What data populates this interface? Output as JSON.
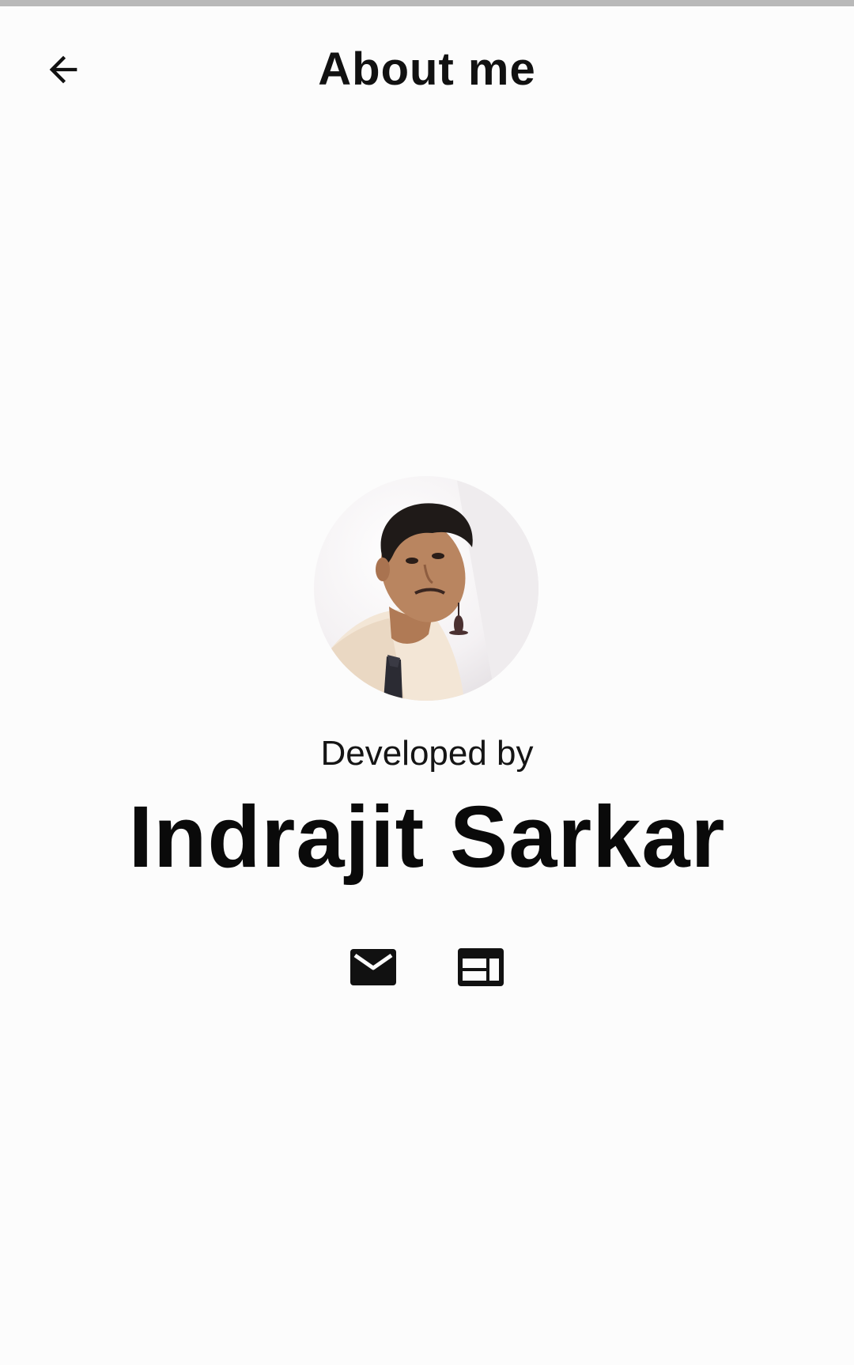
{
  "app_bar": {
    "title": "About me",
    "back_icon": "arrow-left-icon"
  },
  "profile": {
    "developed_by_label": "Developed by",
    "name": "Indrajit Sarkar",
    "photo": "avatar"
  },
  "contacts": [
    {
      "icon": "mail-icon"
    },
    {
      "icon": "web-icon"
    }
  ],
  "colors": {
    "background": "#fcfcfc",
    "text": "#111111",
    "icon": "#111111",
    "status_bar": "#b9b9b9"
  }
}
